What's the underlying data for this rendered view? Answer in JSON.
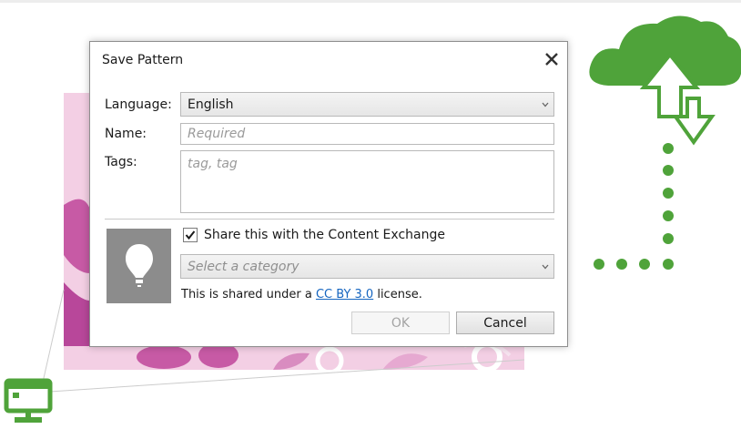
{
  "dialog": {
    "title": "Save Pattern",
    "language_label": "Language:",
    "language_value": "English",
    "name_label": "Name:",
    "name_placeholder": "Required",
    "tags_label": "Tags:",
    "tags_placeholder": "tag, tag",
    "share_label": "Share this with the Content Exchange",
    "share_checked": true,
    "category_placeholder": "Select a category",
    "license_prefix": "This is shared under a ",
    "license_link": "CC BY 3.0",
    "license_suffix": " license.",
    "ok_label": "OK",
    "cancel_label": "Cancel"
  },
  "icons": {
    "close": "close-icon",
    "dropdown": "chevron-down-icon",
    "thumbnail": "lightbulb-icon",
    "cloud": "cloud-upload-download-icon",
    "computer": "monitor-icon"
  },
  "colors": {
    "accent_green": "#4fa33a",
    "pattern_pink": "#c75aa5",
    "link_blue": "#1565c0"
  }
}
